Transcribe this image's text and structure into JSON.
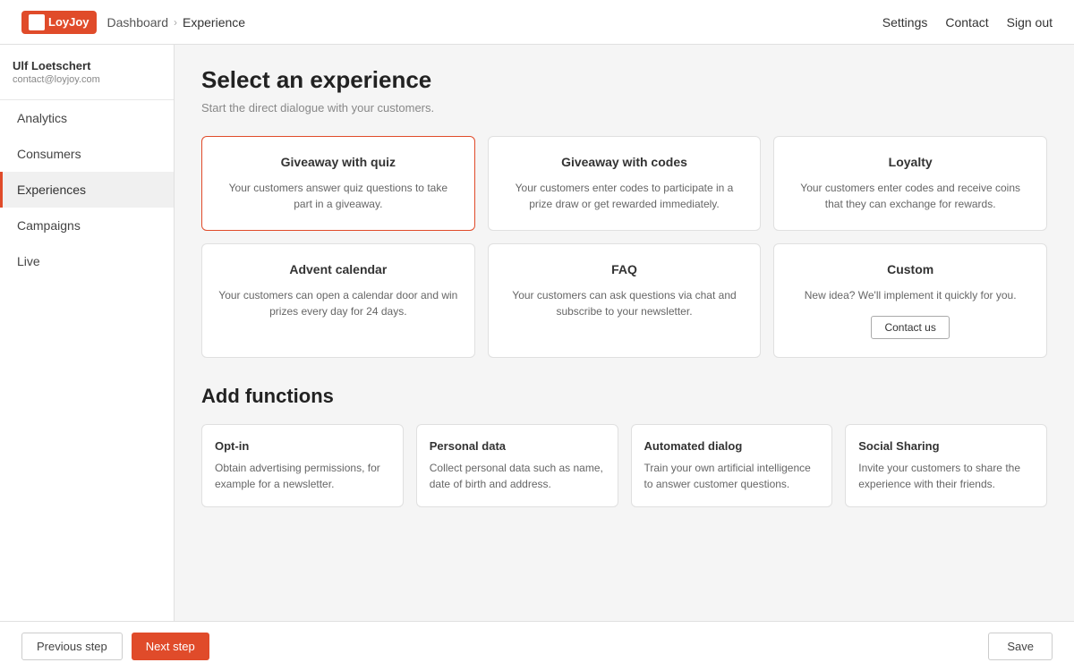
{
  "app": {
    "logo_text": "LoyJoy",
    "header": {
      "breadcrumb_home": "Dashboard",
      "breadcrumb_sep": "›",
      "breadcrumb_current": "Experience",
      "nav_settings": "Settings",
      "nav_contact": "Contact",
      "nav_signout": "Sign out"
    }
  },
  "sidebar": {
    "user": {
      "name": "Ulf Loetschert",
      "email": "contact@loyjoy.com"
    },
    "items": [
      {
        "id": "analytics",
        "label": "Analytics",
        "active": false
      },
      {
        "id": "consumers",
        "label": "Consumers",
        "active": false
      },
      {
        "id": "experiences",
        "label": "Experiences",
        "active": true
      },
      {
        "id": "campaigns",
        "label": "Campaigns",
        "active": false
      },
      {
        "id": "live",
        "label": "Live",
        "active": false
      }
    ]
  },
  "main": {
    "title": "Select an experience",
    "subtitle": "Start the direct dialogue with your customers.",
    "experience_cards": [
      {
        "id": "giveaway-quiz",
        "title": "Giveaway with quiz",
        "desc": "Your customers answer quiz questions to take part in a giveaway.",
        "selected": true
      },
      {
        "id": "giveaway-codes",
        "title": "Giveaway with codes",
        "desc": "Your customers enter codes to participate in a prize draw or get rewarded immediately.",
        "selected": false
      },
      {
        "id": "loyalty",
        "title": "Loyalty",
        "desc": "Your customers enter codes and receive coins that they can exchange for rewards.",
        "selected": false
      },
      {
        "id": "advent-calendar",
        "title": "Advent calendar",
        "desc": "Your customers can open a calendar door and win prizes every day for 24 days.",
        "selected": false
      },
      {
        "id": "faq",
        "title": "FAQ",
        "desc": "Your customers can ask questions via chat and subscribe to your newsletter.",
        "selected": false
      },
      {
        "id": "custom",
        "title": "Custom",
        "desc": "New idea? We'll implement it quickly for you.",
        "has_button": true,
        "button_label": "Contact us",
        "selected": false
      }
    ],
    "functions_title": "Add functions",
    "function_cards": [
      {
        "id": "opt-in",
        "title": "Opt-in",
        "desc": "Obtain advertising permissions, for example for a newsletter."
      },
      {
        "id": "personal-data",
        "title": "Personal data",
        "desc": "Collect personal data such as name, date of birth and address."
      },
      {
        "id": "automated-dialog",
        "title": "Automated dialog",
        "desc": "Train your own artificial intelligence to answer customer questions."
      },
      {
        "id": "social-sharing",
        "title": "Social Sharing",
        "desc": "Invite your customers to share the experience with their friends."
      }
    ]
  },
  "footer": {
    "btn_prev": "Previous step",
    "btn_next": "Next step",
    "btn_save": "Save"
  }
}
